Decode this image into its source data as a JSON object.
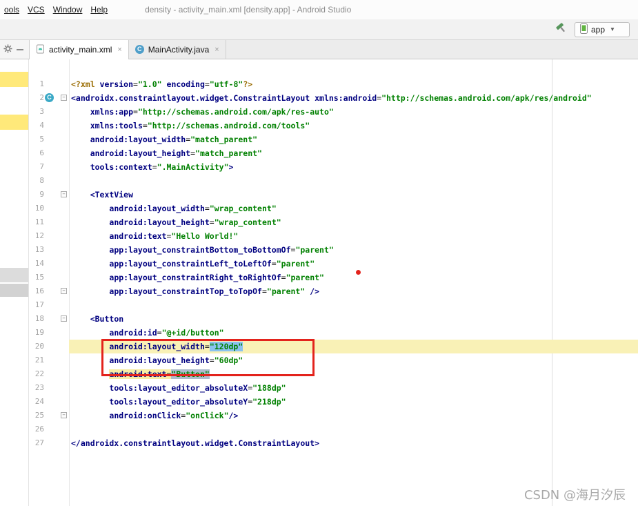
{
  "menu": {
    "items": [
      "ools",
      "VCS",
      "Window",
      "Help"
    ],
    "title": "density - activity_main.xml [density.app] - Android Studio"
  },
  "toolbar": {
    "run_config_label": "app"
  },
  "icons": {
    "close": "×",
    "dropdown": "▼",
    "fold": "−",
    "class_letter": "C"
  },
  "tabs": [
    {
      "label": "activity_main.xml",
      "icon": "android-layout-file-icon",
      "active": true
    },
    {
      "label": "MainActivity.java",
      "icon": "java-class-icon",
      "active": false
    }
  ],
  "colors": {
    "annotation_red": "#e3231c",
    "selection_blue": "#8ac2ef",
    "highlight_yellow": "#f7eda6",
    "current_line": "#f9f1b6",
    "tag_navy": "#000080",
    "value_green": "#008000"
  },
  "watermark": {
    "text": "CSDN @海月汐辰"
  },
  "editor": {
    "lines": [
      {
        "n": 1,
        "ind": 0,
        "tokens": [
          {
            "t": "<?xml ",
            "c": "pi"
          },
          {
            "t": "version",
            "c": "attr"
          },
          {
            "t": "=",
            "c": "pln"
          },
          {
            "t": "\"1.0\"",
            "c": "val"
          },
          {
            "t": " ",
            "c": "pln"
          },
          {
            "t": "encoding",
            "c": "attr"
          },
          {
            "t": "=",
            "c": "pln"
          },
          {
            "t": "\"utf-8\"",
            "c": "val"
          },
          {
            "t": "?>",
            "c": "pi"
          }
        ]
      },
      {
        "n": 2,
        "ind": 0,
        "icon": "C",
        "fold": true,
        "tokens": [
          {
            "t": "<androidx.constraintlayout.widget.ConstraintLayout ",
            "c": "tag"
          },
          {
            "t": "xmlns:android",
            "c": "attr"
          },
          {
            "t": "=",
            "c": "pln"
          },
          {
            "t": "\"http://schemas.android.com/apk/res/android\"",
            "c": "val"
          }
        ]
      },
      {
        "n": 3,
        "ind": 4,
        "tokens": [
          {
            "t": "xmlns:app",
            "c": "attr"
          },
          {
            "t": "=",
            "c": "pln"
          },
          {
            "t": "\"http://schemas.android.com/apk/res-auto\"",
            "c": "val"
          }
        ]
      },
      {
        "n": 4,
        "ind": 4,
        "tokens": [
          {
            "t": "xmlns:tools",
            "c": "attr"
          },
          {
            "t": "=",
            "c": "pln"
          },
          {
            "t": "\"http://schemas.android.com/tools\"",
            "c": "val"
          }
        ]
      },
      {
        "n": 5,
        "ind": 4,
        "tokens": [
          {
            "t": "android:layout_width",
            "c": "attr"
          },
          {
            "t": "=",
            "c": "pln"
          },
          {
            "t": "\"match_parent\"",
            "c": "val"
          }
        ]
      },
      {
        "n": 6,
        "ind": 4,
        "tokens": [
          {
            "t": "android:layout_height",
            "c": "attr"
          },
          {
            "t": "=",
            "c": "pln"
          },
          {
            "t": "\"match_parent\"",
            "c": "val"
          }
        ]
      },
      {
        "n": 7,
        "ind": 4,
        "tokens": [
          {
            "t": "tools:context",
            "c": "attr"
          },
          {
            "t": "=",
            "c": "pln"
          },
          {
            "t": "\".MainActivity\"",
            "c": "val"
          },
          {
            "t": ">",
            "c": "tag"
          }
        ]
      },
      {
        "n": 8,
        "ind": 0,
        "tokens": []
      },
      {
        "n": 9,
        "ind": 4,
        "fold": true,
        "tokens": [
          {
            "t": "<TextView",
            "c": "tag"
          }
        ]
      },
      {
        "n": 10,
        "ind": 8,
        "tokens": [
          {
            "t": "android:layout_width",
            "c": "attr"
          },
          {
            "t": "=",
            "c": "pln"
          },
          {
            "t": "\"wrap_content\"",
            "c": "val"
          }
        ]
      },
      {
        "n": 11,
        "ind": 8,
        "tokens": [
          {
            "t": "android:layout_height",
            "c": "attr"
          },
          {
            "t": "=",
            "c": "pln"
          },
          {
            "t": "\"wrap_content\"",
            "c": "val"
          }
        ]
      },
      {
        "n": 12,
        "ind": 8,
        "tokens": [
          {
            "t": "android:text",
            "c": "attr"
          },
          {
            "t": "=",
            "c": "pln"
          },
          {
            "t": "\"Hello World!\"",
            "c": "val"
          }
        ]
      },
      {
        "n": 13,
        "ind": 8,
        "tokens": [
          {
            "t": "app:layout_constraintBottom_toBottomOf",
            "c": "attr"
          },
          {
            "t": "=",
            "c": "pln"
          },
          {
            "t": "\"parent\"",
            "c": "val"
          }
        ]
      },
      {
        "n": 14,
        "ind": 8,
        "tokens": [
          {
            "t": "app:layout_constraintLeft_toLeftOf",
            "c": "attr"
          },
          {
            "t": "=",
            "c": "pln"
          },
          {
            "t": "\"parent\"",
            "c": "val"
          }
        ]
      },
      {
        "n": 15,
        "ind": 8,
        "tokens": [
          {
            "t": "app:layout_constraintRight_toRightOf",
            "c": "attr"
          },
          {
            "t": "=",
            "c": "pln"
          },
          {
            "t": "\"parent\"",
            "c": "val"
          }
        ]
      },
      {
        "n": 16,
        "ind": 8,
        "fold": true,
        "tokens": [
          {
            "t": "app:layout_constraintTop_toTopOf",
            "c": "attr"
          },
          {
            "t": "=",
            "c": "pln"
          },
          {
            "t": "\"parent\"",
            "c": "val"
          },
          {
            "t": " />",
            "c": "tag"
          }
        ]
      },
      {
        "n": 17,
        "ind": 0,
        "tokens": []
      },
      {
        "n": 18,
        "ind": 4,
        "fold": true,
        "tokens": [
          {
            "t": "<Button",
            "c": "tag"
          }
        ]
      },
      {
        "n": 19,
        "ind": 8,
        "tokens": [
          {
            "t": "android:id",
            "c": "attr"
          },
          {
            "t": "=",
            "c": "pln"
          },
          {
            "t": "\"@+id/button\"",
            "c": "val"
          }
        ]
      },
      {
        "n": 20,
        "ind": 8,
        "cur": true,
        "tokens": [
          {
            "t": "android:layout_width",
            "c": "attr"
          },
          {
            "t": "=",
            "c": "pln"
          },
          {
            "t": "\"120dp\"",
            "c": "val",
            "h": "sel"
          }
        ]
      },
      {
        "n": 21,
        "ind": 8,
        "tokens": [
          {
            "t": "android:layout_height",
            "c": "attr"
          },
          {
            "t": "=",
            "c": "pln"
          },
          {
            "t": "\"60dp\"",
            "c": "val"
          }
        ]
      },
      {
        "n": 22,
        "ind": 8,
        "tokens": [
          {
            "t": "android:text",
            "c": "attr",
            "h": "find"
          },
          {
            "t": "=",
            "c": "pln",
            "h": "find"
          },
          {
            "t": "\"Button\"",
            "c": "val",
            "h": "gray"
          }
        ]
      },
      {
        "n": 23,
        "ind": 8,
        "tokens": [
          {
            "t": "tools:layout_editor_absoluteX",
            "c": "attr"
          },
          {
            "t": "=",
            "c": "pln"
          },
          {
            "t": "\"188dp\"",
            "c": "val"
          }
        ]
      },
      {
        "n": 24,
        "ind": 8,
        "tokens": [
          {
            "t": "tools:layout_editor_absoluteY",
            "c": "attr"
          },
          {
            "t": "=",
            "c": "pln"
          },
          {
            "t": "\"218dp\"",
            "c": "val"
          }
        ]
      },
      {
        "n": 25,
        "ind": 8,
        "fold": true,
        "tokens": [
          {
            "t": "android:onClick",
            "c": "attr"
          },
          {
            "t": "=",
            "c": "pln"
          },
          {
            "t": "\"onClick\"",
            "c": "val"
          },
          {
            "t": "/>",
            "c": "tag"
          }
        ]
      },
      {
        "n": 26,
        "ind": 0,
        "tokens": []
      },
      {
        "n": 27,
        "ind": 0,
        "tokens": [
          {
            "t": "</androidx.constraintlayout.widget.ConstraintLayout>",
            "c": "tag"
          }
        ]
      }
    ]
  }
}
